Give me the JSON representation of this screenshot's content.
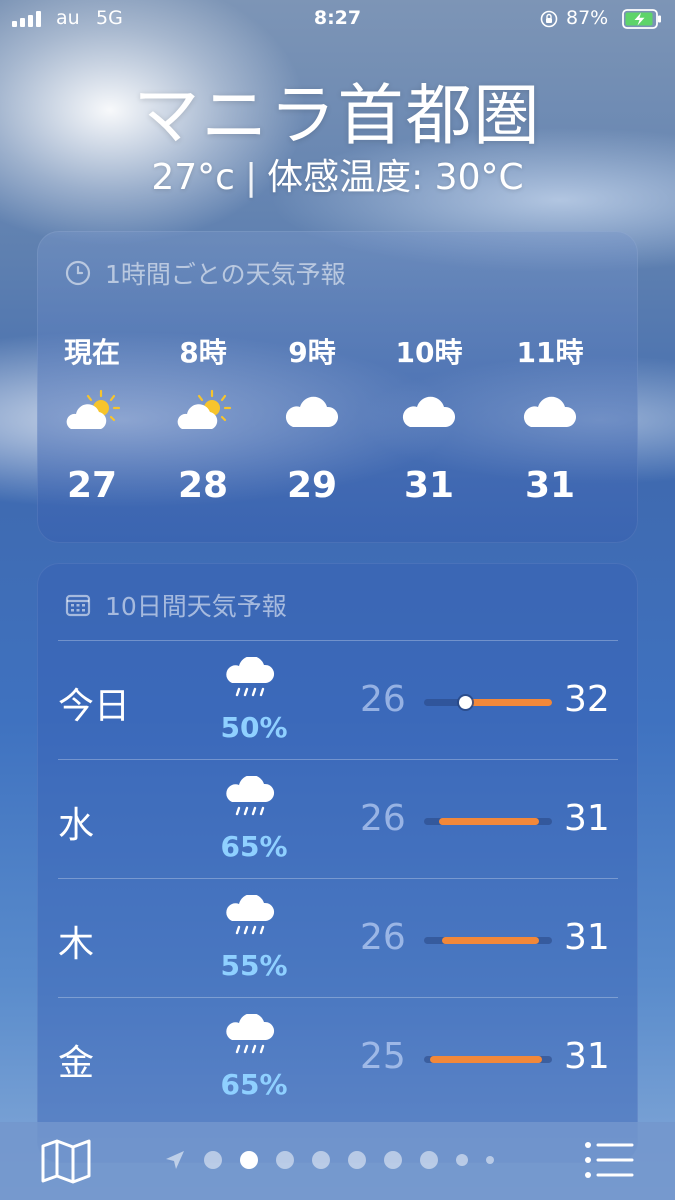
{
  "status": {
    "carrier": "au",
    "network": "5G",
    "time": "8:27",
    "battery": "87%"
  },
  "header": {
    "city": "マニラ首都圏",
    "temp": "27°c",
    "feels": "体感温度: 30°C"
  },
  "hourly": {
    "title": "1時間ごとの天気予報",
    "items": [
      {
        "label": "現在",
        "icon": "partly-cloudy-icon",
        "temp": "27"
      },
      {
        "label": "8時",
        "icon": "partly-cloudy-icon",
        "temp": "28"
      },
      {
        "label": "9時",
        "icon": "cloud-icon",
        "temp": "29"
      },
      {
        "label": "10時",
        "icon": "cloud-icon",
        "temp": "31"
      },
      {
        "label": "11時",
        "icon": "cloud-icon",
        "temp": "31"
      }
    ]
  },
  "daily": {
    "title": "10日間天気予報",
    "items": [
      {
        "day": "今日",
        "icon": "rain-icon",
        "pop": "50%",
        "low": "26",
        "high": "32",
        "range_start": 0.28,
        "range_end": 1.0,
        "current": 0.32
      },
      {
        "day": "水",
        "icon": "rain-icon",
        "pop": "65%",
        "low": "26",
        "high": "31",
        "range_start": 0.12,
        "range_end": 0.9
      },
      {
        "day": "木",
        "icon": "rain-icon",
        "pop": "55%",
        "low": "26",
        "high": "31",
        "range_start": 0.14,
        "range_end": 0.9
      },
      {
        "day": "金",
        "icon": "rain-icon",
        "pop": "65%",
        "low": "25",
        "high": "31",
        "range_start": 0.05,
        "range_end": 0.92
      }
    ]
  },
  "bottombar": {
    "pages": 9,
    "active_page": 2
  }
}
